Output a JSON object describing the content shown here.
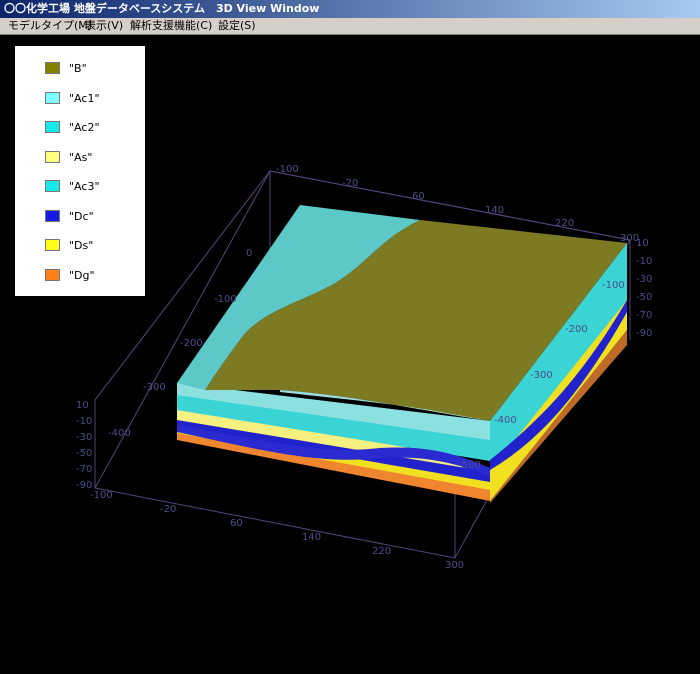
{
  "window": {
    "title": "〇〇化学工場 地盤データベースシステム　3D View Window"
  },
  "menu": [
    {
      "label": "モデルタイプ(M)"
    },
    {
      "label": "表示(V)"
    },
    {
      "label": "解析支援機能(C)"
    },
    {
      "label": "設定(S)"
    }
  ],
  "legend": {
    "items": [
      {
        "label": "\"B\"",
        "color": "#7f7f00"
      },
      {
        "label": "\"Ac1\"",
        "color": "#7fffff"
      },
      {
        "label": "\"Ac2\"",
        "color": "#19e6e6"
      },
      {
        "label": "\"As\"",
        "color": "#ffff7f"
      },
      {
        "label": "\"Ac3\"",
        "color": "#19e6e6"
      },
      {
        "label": "\"Dc\"",
        "color": "#1919e6"
      },
      {
        "label": "\"Ds\"",
        "color": "#ffff19"
      },
      {
        "label": "\"Dg\"",
        "color": "#ff7f19"
      }
    ]
  },
  "axes": {
    "back_top": [
      "-100",
      "-20",
      "60",
      "140",
      "220",
      "300"
    ],
    "left_back": [
      "0",
      "-100",
      "-200",
      "-300",
      "-400"
    ],
    "right_back": [
      "-100",
      "-200",
      "-300",
      "-400",
      "-500"
    ],
    "z_left": [
      "10",
      "-10",
      "-30",
      "-50",
      "-70",
      "-90"
    ],
    "z_right": [
      "10",
      "-10",
      "-30",
      "-50",
      "-70",
      "-90"
    ],
    "front_bottom": [
      "-100",
      "-20",
      "60",
      "140",
      "220",
      "300"
    ]
  },
  "colors": {
    "box_edge": "#55447a",
    "axis_label": "#4d4d8a",
    "surface_b": "#7c7a22",
    "surface_ac": "#57c6c6"
  }
}
